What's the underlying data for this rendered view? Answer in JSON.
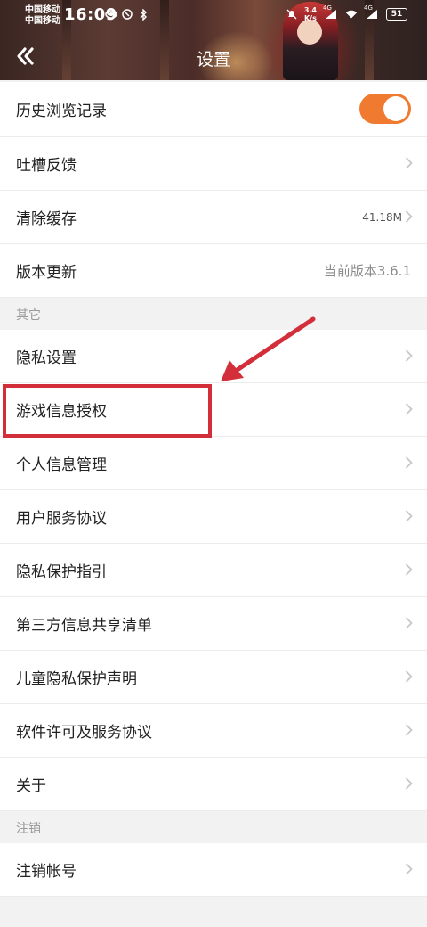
{
  "status_bar": {
    "carrier_line1": "中国移动",
    "carrier_line2": "中国移动",
    "time": "16:09",
    "net_speed_value": "3.4",
    "net_speed_unit": "K/s",
    "net_label_1": "4G",
    "net_label_2": "4G",
    "battery": "51"
  },
  "nav": {
    "title": "设置"
  },
  "settings": {
    "history_label": "历史浏览记录",
    "history_toggle_on": true,
    "feedback_label": "吐槽反馈",
    "cache_label": "清除缓存",
    "cache_value": "41.18M",
    "update_label": "版本更新",
    "update_value": "当前版本3.6.1"
  },
  "section_other": {
    "header": "其它",
    "items": [
      "隐私设置",
      "游戏信息授权",
      "个人信息管理",
      "用户服务协议",
      "隐私保护指引",
      "第三方信息共享清单",
      "儿童隐私保护声明",
      "软件许可及服务协议",
      "关于"
    ]
  },
  "section_logout": {
    "header": "注销",
    "items": [
      "注销帐号"
    ]
  },
  "annotation": {
    "highlight_color": "#d32f3a"
  },
  "colors": {
    "toggle_on": "#f07a30",
    "background": "#f2f2f2",
    "annotation": "#d32f3a"
  }
}
